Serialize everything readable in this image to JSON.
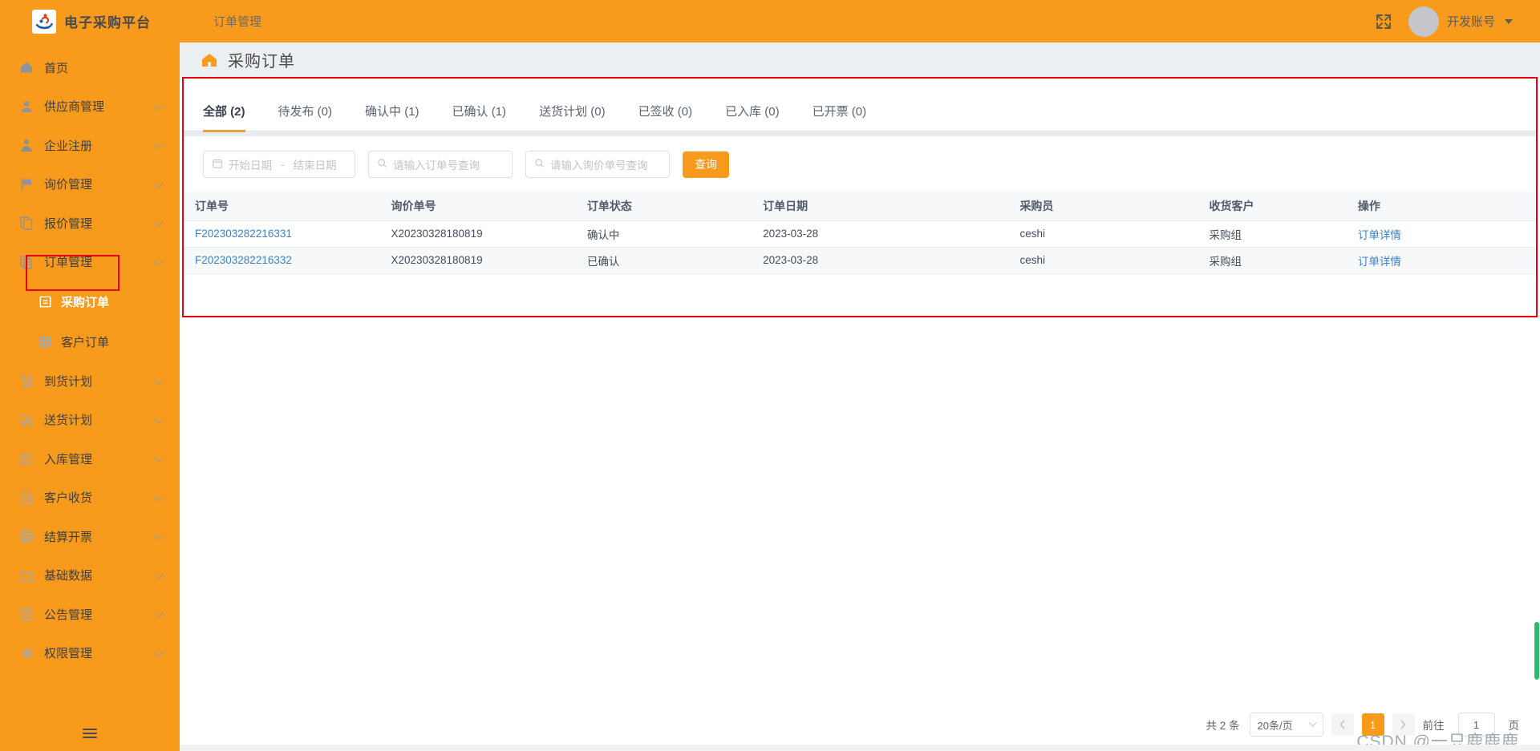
{
  "header": {
    "brand_name": "电子采购平台",
    "brand_logo_icon": "platform-logo-icon",
    "nav": [
      {
        "label": "订单管理"
      }
    ],
    "fullscreen_icon": "fullscreen-icon",
    "user_name": "开发账号",
    "caret_icon": "chevron-down-icon"
  },
  "sidebar": {
    "items": [
      {
        "label": "首页",
        "icon": "home-icon",
        "expandable": false
      },
      {
        "label": "供应商管理",
        "icon": "user-icon",
        "expandable": true
      },
      {
        "label": "企业注册",
        "icon": "user-badge-icon",
        "expandable": true
      },
      {
        "label": "询价管理",
        "icon": "flag-icon",
        "expandable": true
      },
      {
        "label": "报价管理",
        "icon": "copy-icon",
        "expandable": true
      },
      {
        "label": "订单管理",
        "icon": "order-icon",
        "expandable": true
      },
      {
        "label": "到货计划",
        "icon": "cart-icon",
        "expandable": true
      },
      {
        "label": "送货计划",
        "icon": "truck-icon",
        "expandable": true
      },
      {
        "label": "入库管理",
        "icon": "inbox-icon",
        "expandable": true
      },
      {
        "label": "客户收货",
        "icon": "doc-check-icon",
        "expandable": true
      },
      {
        "label": "结算开票",
        "icon": "printer-icon",
        "expandable": true
      },
      {
        "label": "基础数据",
        "icon": "folder-icon",
        "expandable": true
      },
      {
        "label": "公告管理",
        "icon": "notice-icon",
        "expandable": true
      },
      {
        "label": "权限管理",
        "icon": "gear-icon",
        "expandable": true
      }
    ],
    "submenu": [
      {
        "label": "采购订单",
        "icon": "order-icon",
        "active": true
      },
      {
        "label": "客户订单",
        "icon": "grid-icon",
        "active": false
      }
    ],
    "collapse_icon": "menu-collapse-icon",
    "highlight_color": "#E60012"
  },
  "page": {
    "home_icon": "home-solid-icon",
    "title": "采购订单"
  },
  "tabs": [
    {
      "label": "全部 (2)",
      "active": true
    },
    {
      "label": "待发布 (0)",
      "active": false
    },
    {
      "label": "确认中 (1)",
      "active": false
    },
    {
      "label": "已确认 (1)",
      "active": false
    },
    {
      "label": "送货计划 (0)",
      "active": false
    },
    {
      "label": "已签收 (0)",
      "active": false
    },
    {
      "label": "已入库 (0)",
      "active": false
    },
    {
      "label": "已开票 (0)",
      "active": false
    }
  ],
  "filters": {
    "calendar_icon": "calendar-icon",
    "date_start_placeholder": "开始日期",
    "date_separator": "-",
    "date_end_placeholder": "结束日期",
    "search_icon": "search-icon",
    "order_no_placeholder": "请输入订单号查询",
    "inquiry_no_placeholder": "请输入询价单号查询",
    "query_button": "查询"
  },
  "table": {
    "columns": [
      "订单号",
      "询价单号",
      "订单状态",
      "订单日期",
      "采购员",
      "收货客户",
      "操作"
    ],
    "rows": [
      {
        "order_no": "F202303282216331",
        "inquiry_no": "X20230328180819",
        "status": "确认中",
        "order_date": "2023-03-28",
        "buyer": "ceshi",
        "customer": "采购组",
        "action": "订单详情"
      },
      {
        "order_no": "F202303282216332",
        "inquiry_no": "X20230328180819",
        "status": "已确认",
        "order_date": "2023-03-28",
        "buyer": "ceshi",
        "customer": "采购组",
        "action": "订单详情"
      }
    ]
  },
  "pagination": {
    "total_text": "共 2 条",
    "page_size": "20条/页",
    "prev_icon": "chevron-left-icon",
    "current_page": "1",
    "next_icon": "chevron-right-icon",
    "jump_label": "前往",
    "jump_value": "1",
    "jump_unit": "页"
  },
  "watermark": "CSDN @一只鹿鹿鹿",
  "theme": {
    "accent": "#F89B1C",
    "link": "#3b82c4",
    "tab_underline": "#E6A23C",
    "highlight_border": "#E60012"
  }
}
